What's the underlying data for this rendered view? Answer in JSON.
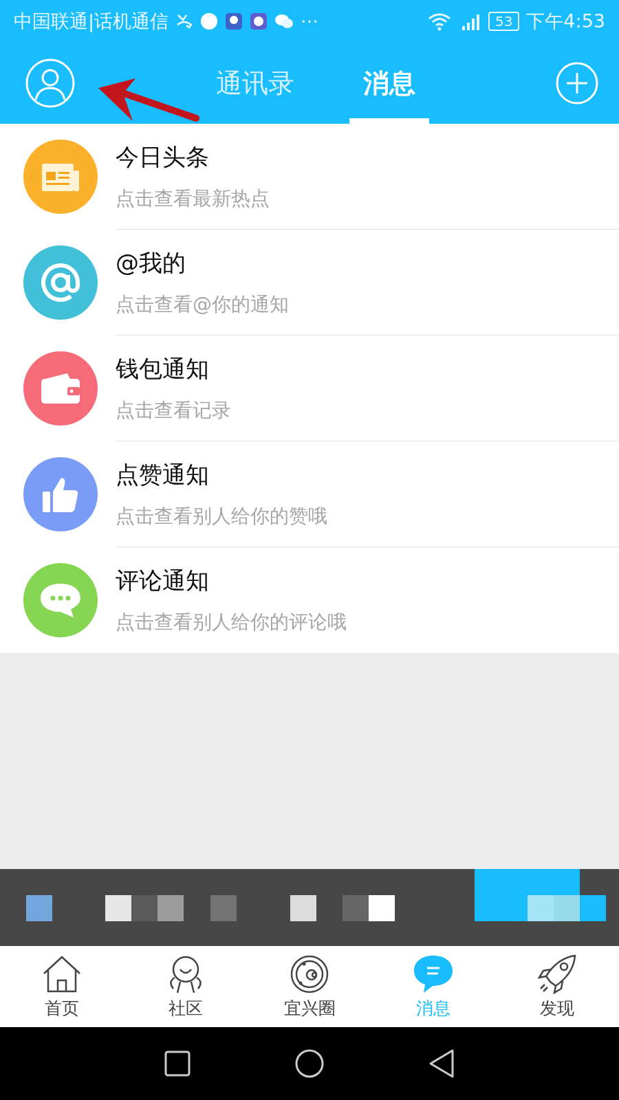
{
  "status_bar": {
    "carrier": "中国联通|话机通信",
    "more": "···",
    "battery": "53",
    "time": "下午4:53"
  },
  "header": {
    "tabs": [
      {
        "label": "通讯录",
        "selected": false
      },
      {
        "label": "消息",
        "selected": true
      }
    ]
  },
  "messages": [
    {
      "kind": "news",
      "title": "今日头条",
      "subtitle": "点击查看最新热点",
      "color": "#fbb12b"
    },
    {
      "kind": "mention",
      "title": "@我的",
      "subtitle": "点击查看@你的通知",
      "color": "#43c0d9"
    },
    {
      "kind": "wallet",
      "title": "钱包通知",
      "subtitle": "点击查看记录",
      "color": "#f56b78"
    },
    {
      "kind": "like",
      "title": "点赞通知",
      "subtitle": "点击查看别人给你的赞哦",
      "color": "#7b9cf6"
    },
    {
      "kind": "comment",
      "title": "评论通知",
      "subtitle": "点击查看别人给你的评论哦",
      "color": "#86d653"
    }
  ],
  "tab_bar": [
    {
      "kind": "home",
      "label": "首页",
      "selected": false
    },
    {
      "kind": "community",
      "label": "社区",
      "selected": false
    },
    {
      "kind": "circle",
      "label": "宜兴圈",
      "selected": false
    },
    {
      "kind": "message",
      "label": "消息",
      "selected": true
    },
    {
      "kind": "discover",
      "label": "发现",
      "selected": false
    }
  ]
}
